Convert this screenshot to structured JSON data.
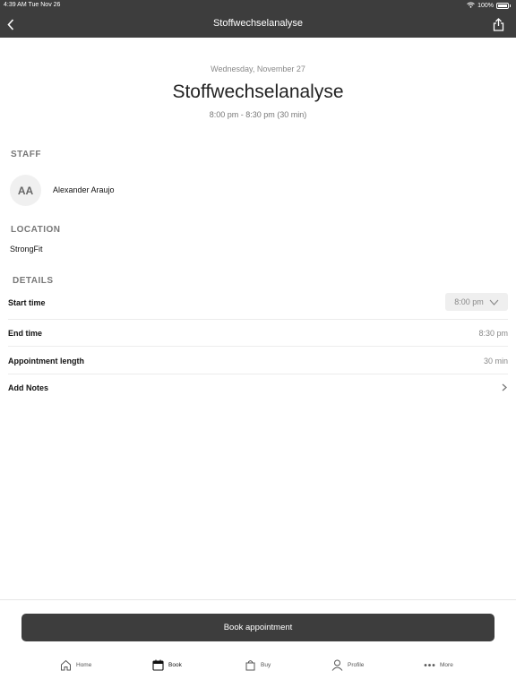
{
  "status_bar": {
    "time": "4:39 AM  Tue Nov 26",
    "battery": "100%"
  },
  "nav": {
    "title": "Stoffwechselanalyse"
  },
  "appointment": {
    "date": "Wednesday, November 27",
    "title": "Stoffwechselanalyse",
    "timespan": "8:00 pm - 8:30 pm (30 min)"
  },
  "staff": {
    "heading": "STAFF",
    "initials": "AA",
    "name": "Alexander Araujo"
  },
  "location": {
    "heading": "LOCATION",
    "name": "StrongFit"
  },
  "details": {
    "heading": "DETAILS",
    "start_label": "Start time",
    "start_value": "8:00 pm",
    "end_label": "End time",
    "end_value": "8:30 pm",
    "length_label": "Appointment length",
    "length_value": "30 min",
    "notes_label": "Add Notes"
  },
  "book_button": "Book appointment",
  "tabs": [
    {
      "label": "Home",
      "icon": "home-icon"
    },
    {
      "label": "Book",
      "icon": "calendar-icon"
    },
    {
      "label": "Buy",
      "icon": "bag-icon"
    },
    {
      "label": "Profile",
      "icon": "person-icon"
    },
    {
      "label": "More",
      "icon": "more-icon"
    }
  ],
  "colors": {
    "bar": "#3d3d3d",
    "muted": "#888888",
    "background": "#ffffff"
  }
}
